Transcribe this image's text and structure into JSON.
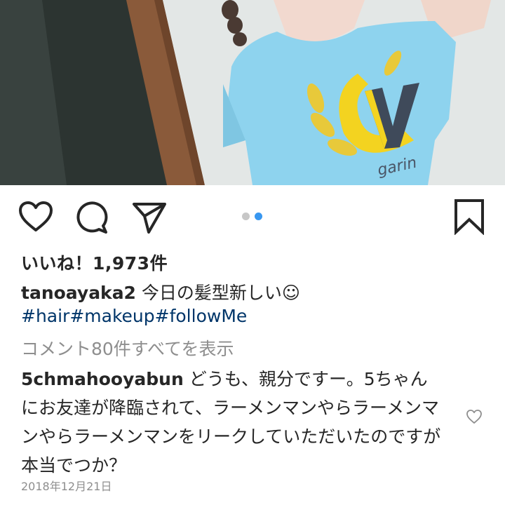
{
  "post": {
    "likes_text": "いいね！1,973件",
    "caption_user": "tanoayaka2",
    "caption_text": " 今日の髪型新しい☺",
    "hashtags": "#hair#makeup#followMe",
    "view_comments": "コメント80件すべてを表示",
    "date": "2018年12月21日"
  },
  "comment": {
    "user": "5chmahooyabun",
    "text": " どうも、親分ですー。5ちゃんにお友達が降臨されて、ラーメンマンやらラーメンマンやらラーメンマンをリークしていただいたのですが本当でつか？"
  },
  "pager": {
    "total": 2,
    "active": 2
  },
  "colors": {
    "text": "#262626",
    "muted": "#8e8e8e",
    "hashtag": "#003569",
    "pager_active": "#3897f0",
    "pager_inactive": "#c7c7c7",
    "shirt": "#8ed3ee"
  },
  "icons": {
    "like": "heart-outline-icon",
    "comment": "comment-bubble-icon",
    "share": "paper-plane-icon",
    "save": "bookmark-outline-icon",
    "comment_like": "small-heart-outline-icon"
  }
}
